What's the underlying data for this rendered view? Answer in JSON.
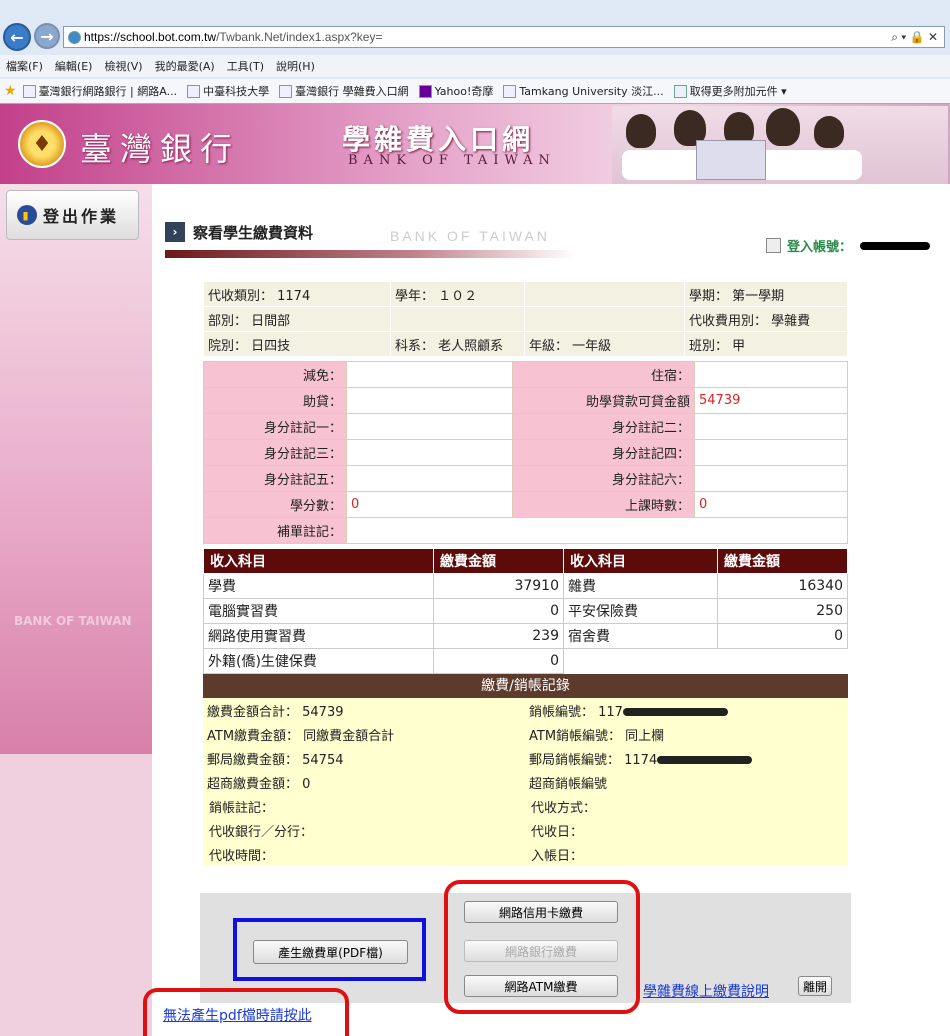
{
  "browser": {
    "url_domain": "https://school.bot.com.tw",
    "url_rest": "/Twbank.Net/index1.aspx?key=",
    "menu": [
      "檔案(F)",
      "編輯(E)",
      "檢視(V)",
      "我的最愛(A)",
      "工具(T)",
      "說明(H)"
    ],
    "favorites": [
      "臺灣銀行網路銀行 | 網路A...",
      "中臺科技大學",
      "臺灣銀行 學雜費入口網",
      "Yahoo!奇摩",
      "Tamkang University 淡江...",
      "取得更多附加元件 ▾"
    ]
  },
  "header": {
    "bank_name": "臺灣銀行",
    "portal_title": "學雜費入口網",
    "portal_en": "BANK OF TAIWAN"
  },
  "sidebar": {
    "logout": "登出作業",
    "watermark": "BANK OF TAIWAN"
  },
  "page": {
    "title": "察看學生繳費資料",
    "title_en": "BANK OF TAIWAN",
    "login_label": "登入帳號："
  },
  "info": {
    "collect_type": "代收類別： 1174",
    "school_year": "學年： １０２",
    "term": "學期： 第一學期",
    "division": "部別： 日間部",
    "fee_use": "代收費用別： 學雜費",
    "college": "院別： 日四技",
    "department": "科系： 老人照顧系",
    "grade": "年級： 一年級",
    "class": "班別： 甲"
  },
  "detail": {
    "rows": [
      {
        "l1": "減免：",
        "v1": "",
        "l2": "住宿：",
        "v2": ""
      },
      {
        "l1": "助貸：",
        "v1": "",
        "l2": "助學貸款可貸金額",
        "v2": "54739"
      },
      {
        "l1": "身分註記一：",
        "v1": "",
        "l2": "身分註記二：",
        "v2": ""
      },
      {
        "l1": "身分註記三：",
        "v1": "",
        "l2": "身分註記四：",
        "v2": ""
      },
      {
        "l1": "身分註記五：",
        "v1": "",
        "l2": "身分註記六：",
        "v2": ""
      },
      {
        "l1": "學分數：",
        "v1": "0",
        "l2": "上課時數：",
        "v2": "0"
      }
    ],
    "supplement_label": "補單註記："
  },
  "fees": {
    "headers": [
      "收入科目",
      "繳費金額",
      "收入科目",
      "繳費金額"
    ],
    "rows": [
      {
        "i1": "學費",
        "a1": "37910",
        "i2": "雜費",
        "a2": "16340"
      },
      {
        "i1": "電腦實習費",
        "a1": "0",
        "i2": "平安保險費",
        "a2": "250"
      },
      {
        "i1": "網路使用實習費",
        "a1": "239",
        "i2": "宿舍費",
        "a2": "0"
      },
      {
        "i1": "外籍(僑)生健保費",
        "a1": "0",
        "i2": "",
        "a2": ""
      }
    ]
  },
  "record": {
    "title": "繳費/銷帳記錄",
    "total": "繳費金額合計： 54739",
    "account_no": "銷帳編號： 117",
    "atm_amount": "ATM繳費金額： 同繳費金額合計",
    "atm_account": "ATM銷帳編號： 同上欄",
    "post_amount": "郵局繳費金額： 54754",
    "post_account": "郵局銷帳編號： 1174",
    "store_amount": "超商繳費金額： 0",
    "store_account": "超商銷帳編號",
    "account_note": "銷帳註記：",
    "collect_method": "代收方式：",
    "collect_bank": "代收銀行／分行：",
    "collect_date": "代收日：",
    "collect_time": "代收時間：",
    "entry_date": "入帳日："
  },
  "actions": {
    "credit_card": "網路信用卡繳費",
    "net_bank": "網路銀行繳費",
    "atm": "網路ATM繳費",
    "pdf": "產生繳費單(PDF檔)",
    "online_help": "學雜費線上繳費說明",
    "leave": "離開",
    "pdf_help": "無法產生pdf檔時請按此"
  }
}
